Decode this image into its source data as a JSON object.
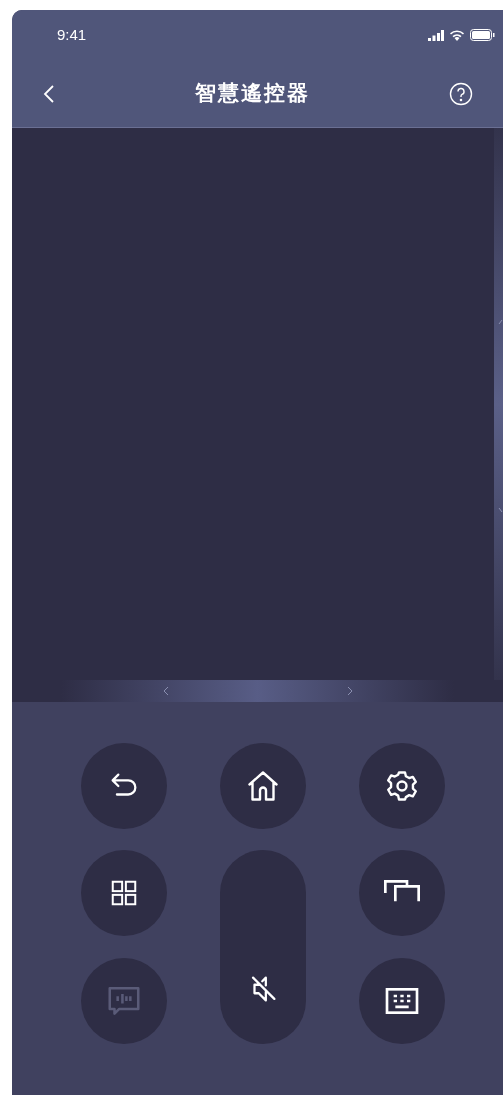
{
  "status_bar": {
    "time": "9:41"
  },
  "header": {
    "title": "智慧遙控器"
  },
  "buttons": [
    {
      "kind": "back",
      "disabled": false
    },
    {
      "kind": "home",
      "disabled": false
    },
    {
      "kind": "settings",
      "disabled": false
    },
    {
      "kind": "apps",
      "disabled": false
    },
    {
      "kind": "volume",
      "disabled": false
    },
    {
      "kind": "windows",
      "disabled": false
    },
    {
      "kind": "voice",
      "disabled": true
    },
    {
      "kind": "keyboard",
      "disabled": false
    }
  ]
}
